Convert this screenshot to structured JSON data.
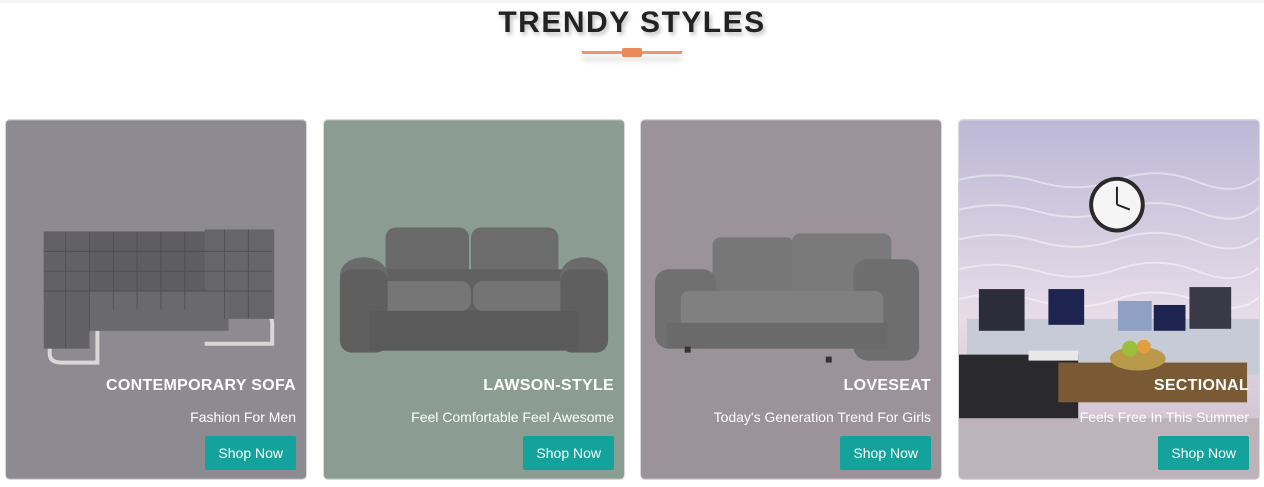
{
  "section": {
    "title": "TRENDY STYLES",
    "accent_color": "#f0956a"
  },
  "cards": [
    {
      "name": "CONTEMPORARY SOFA",
      "subtitle": "Fashion For Men",
      "button": "Shop Now",
      "bg_color": "#8d8b91",
      "image": "sofa-image"
    },
    {
      "name": "LAWSON-STYLE",
      "subtitle": "Feel Comfortable Feel Awesome",
      "button": "Shop Now",
      "bg_color": "#8b9c93",
      "image": "sofa-image"
    },
    {
      "name": "LOVESEAT",
      "subtitle": "Today's Generation Trend For Girls",
      "button": "Shop Now",
      "bg_color": "#9c9299",
      "image": "sofa-image"
    },
    {
      "name": "SECTIONAL",
      "subtitle": "Feels Free In This Summer",
      "button": "Shop Now",
      "bg_color": "#c9c5dc",
      "image": "living-room-image"
    }
  ],
  "button_color": "#13a39c"
}
